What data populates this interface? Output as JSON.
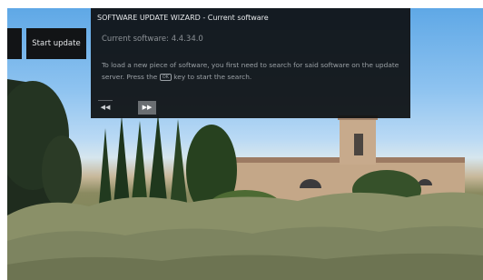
{
  "wizard": {
    "title": "SOFTWARE UPDATE WIZARD - Current software",
    "current_software": "Current software:  4.4.34.0",
    "body_before_key": "To load a new piece of software, you first need to search for said software on the update server. Press the",
    "ok_key": "OK",
    "body_after_key": "key to start the search.",
    "back_icon": "double-chevron-left",
    "forward_icon": "double-chevron-right"
  },
  "side": {
    "start_update_label": "Start update"
  },
  "colors": {
    "panel_bg": "#0e1012",
    "nav_selected": "#6a6e72"
  }
}
